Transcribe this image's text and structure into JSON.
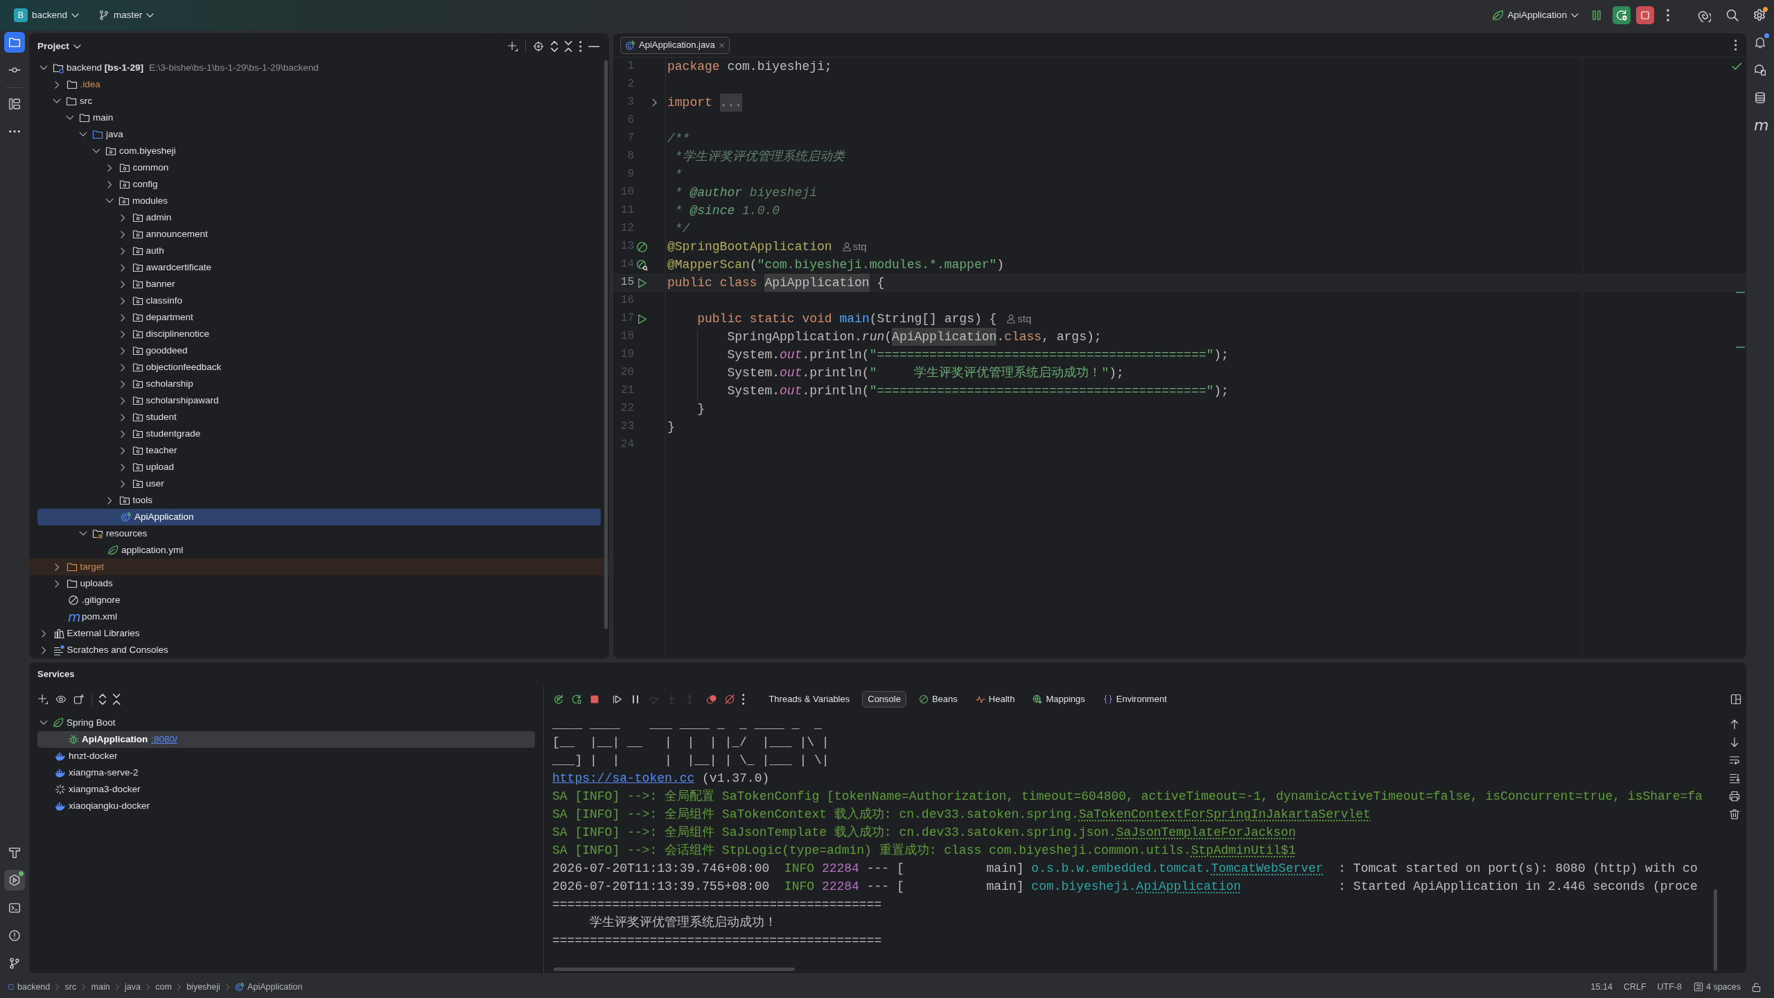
{
  "title_bar": {
    "project_badge": "B",
    "project_name": "backend",
    "branch": "master",
    "run_configuration": "ApiApplication",
    "settings_dot": true
  },
  "left_toolbar": {
    "top": [
      {
        "kind": "project",
        "selected": true
      },
      {
        "kind": "commit",
        "selected": false
      },
      {
        "kind": "structure",
        "selected": false
      },
      {
        "kind": "more",
        "selected": false
      }
    ],
    "bottom": [
      {
        "kind": "build",
        "selected": false,
        "dot": false
      },
      {
        "kind": "services",
        "selected": true,
        "dot": true
      },
      {
        "kind": "terminal",
        "selected": false,
        "dot": false
      },
      {
        "kind": "problems",
        "selected": false,
        "dot": false
      },
      {
        "kind": "git",
        "selected": false,
        "dot": false
      }
    ]
  },
  "right_toolbar": [
    {
      "kind": "notifications",
      "dot": true
    },
    {
      "kind": "ai_chat",
      "dot": false
    },
    {
      "kind": "database",
      "dot": false
    },
    {
      "kind": "maven",
      "glyph": "m",
      "dot": false
    }
  ],
  "project_panel": {
    "title": "Project",
    "tree": [
      {
        "label": "backend",
        "qualifier": "[bs-1-29]",
        "path": "E:\\3-bishe\\bs-1\\bs-1-29\\bs-1-29\\backend",
        "kind": "module",
        "expanded": true,
        "selected": false,
        "children": [
          {
            "label": ".idea",
            "kind": "ignored_folder",
            "expanded": false,
            "selected": false
          },
          {
            "label": "src",
            "kind": "folder",
            "expanded": true,
            "selected": false,
            "children": [
              {
                "label": "main",
                "kind": "folder",
                "expanded": true,
                "selected": false,
                "children": [
                  {
                    "label": "java",
                    "kind": "source_root",
                    "expanded": true,
                    "selected": false,
                    "children": [
                      {
                        "label": "com.biyesheji",
                        "kind": "package",
                        "expanded": true,
                        "selected": false,
                        "children": [
                          {
                            "label": "common",
                            "kind": "package",
                            "expanded": false,
                            "selected": false
                          },
                          {
                            "label": "config",
                            "kind": "package",
                            "expanded": false,
                            "selected": false
                          },
                          {
                            "label": "modules",
                            "kind": "package",
                            "expanded": true,
                            "selected": false,
                            "children": [
                              {
                                "label": "admin",
                                "kind": "package",
                                "expanded": false,
                                "selected": false
                              },
                              {
                                "label": "announcement",
                                "kind": "package",
                                "expanded": false,
                                "selected": false
                              },
                              {
                                "label": "auth",
                                "kind": "package",
                                "expanded": false,
                                "selected": false
                              },
                              {
                                "label": "awardcertificate",
                                "kind": "package",
                                "expanded": false,
                                "selected": false
                              },
                              {
                                "label": "banner",
                                "kind": "package",
                                "expanded": false,
                                "selected": false
                              },
                              {
                                "label": "classinfo",
                                "kind": "package",
                                "expanded": false,
                                "selected": false
                              },
                              {
                                "label": "department",
                                "kind": "package",
                                "expanded": false,
                                "selected": false
                              },
                              {
                                "label": "disciplinenotice",
                                "kind": "package",
                                "expanded": false,
                                "selected": false
                              },
                              {
                                "label": "gooddeed",
                                "kind": "package",
                                "expanded": false,
                                "selected": false
                              },
                              {
                                "label": "objectionfeedback",
                                "kind": "package",
                                "expanded": false,
                                "selected": false
                              },
                              {
                                "label": "scholarship",
                                "kind": "package",
                                "expanded": false,
                                "selected": false
                              },
                              {
                                "label": "scholarshipaward",
                                "kind": "package",
                                "expanded": false,
                                "selected": false
                              },
                              {
                                "label": "student",
                                "kind": "package",
                                "expanded": false,
                                "selected": false
                              },
                              {
                                "label": "studentgrade",
                                "kind": "package",
                                "expanded": false,
                                "selected": false
                              },
                              {
                                "label": "teacher",
                                "kind": "package",
                                "expanded": false,
                                "selected": false
                              },
                              {
                                "label": "upload",
                                "kind": "package",
                                "expanded": false,
                                "selected": false
                              },
                              {
                                "label": "user",
                                "kind": "package",
                                "expanded": false,
                                "selected": false
                              }
                            ]
                          },
                          {
                            "label": "tools",
                            "kind": "package",
                            "expanded": false,
                            "selected": false
                          },
                          {
                            "label": "ApiApplication",
                            "kind": "spring_class",
                            "selected": true
                          }
                        ]
                      }
                    ]
                  },
                  {
                    "label": "resources",
                    "kind": "resources_root",
                    "expanded": true,
                    "selected": false,
                    "children": [
                      {
                        "label": "application.yml",
                        "kind": "spring_config",
                        "selected": false
                      }
                    ]
                  }
                ]
              }
            ]
          },
          {
            "label": "target",
            "kind": "excluded_folder",
            "expanded": false,
            "selected": false
          },
          {
            "label": "uploads",
            "kind": "folder",
            "expanded": false,
            "selected": false
          },
          {
            "label": ".gitignore",
            "kind": "ignore_file",
            "selected": false
          },
          {
            "label": "pom.xml",
            "kind": "maven_file",
            "glyph": "m",
            "selected": false
          }
        ]
      },
      {
        "label": "External Libraries",
        "kind": "libraries",
        "expanded": false,
        "selected": false
      },
      {
        "label": "Scratches and Consoles",
        "kind": "scratches",
        "expanded": false,
        "selected": false
      }
    ]
  },
  "editor": {
    "tabs": [
      {
        "label": "ApiApplication.java",
        "kind": "spring_class",
        "selected": true
      }
    ],
    "analysis_ok": true,
    "lines": [
      {
        "number": "1",
        "kind": "plain",
        "current": false,
        "tokens": [
          {
            "text": "package",
            "kind": "keyword"
          },
          {
            "text": " com.biyesheji;",
            "kind": "plain"
          }
        ]
      },
      {
        "number": "2",
        "kind": "plain",
        "current": false
      },
      {
        "number": "3",
        "kind": "fold",
        "current": false,
        "tokens": [
          {
            "text": "import ",
            "kind": "keyword"
          },
          {
            "text": "...",
            "kind": "folded"
          }
        ]
      },
      {
        "number": "6",
        "kind": "plain",
        "current": false
      },
      {
        "number": "7",
        "kind": "plain",
        "current": false,
        "tokens": [
          {
            "text": "/**",
            "kind": "doc"
          }
        ]
      },
      {
        "number": "8",
        "kind": "plain",
        "current": false,
        "tokens": [
          {
            "text": " *学生评奖评优管理系统启动类",
            "kind": "doc"
          }
        ]
      },
      {
        "number": "9",
        "kind": "plain",
        "current": false,
        "tokens": [
          {
            "text": " *",
            "kind": "doc"
          }
        ]
      },
      {
        "number": "10",
        "kind": "plain",
        "current": false,
        "tokens": [
          {
            "text": " * ",
            "kind": "doc"
          },
          {
            "text": "@author",
            "kind": "doc_tag"
          },
          {
            "text": " biyesheji",
            "kind": "doc"
          }
        ]
      },
      {
        "number": "11",
        "kind": "plain",
        "current": false,
        "tokens": [
          {
            "text": " * ",
            "kind": "doc"
          },
          {
            "text": "@since",
            "kind": "doc_tag"
          },
          {
            "text": " 1.0.0",
            "kind": "doc"
          }
        ]
      },
      {
        "number": "12",
        "kind": "plain",
        "current": false,
        "tokens": [
          {
            "text": " */",
            "kind": "doc"
          }
        ]
      },
      {
        "number": "13",
        "kind": "bean",
        "current": false,
        "hint": "stq",
        "tokens": [
          {
            "text": "@SpringBootApplication",
            "kind": "annotation"
          }
        ]
      },
      {
        "number": "14",
        "kind": "bean_search",
        "current": false,
        "tokens": [
          {
            "text": "@MapperScan",
            "kind": "annotation"
          },
          {
            "text": "(",
            "kind": "plain"
          },
          {
            "text": "\"com.biyesheji.modules.*.mapper\"",
            "kind": "string"
          },
          {
            "text": ")",
            "kind": "plain"
          }
        ]
      },
      {
        "number": "15",
        "kind": "run",
        "current": true,
        "tokens": [
          {
            "text": "public ",
            "kind": "keyword"
          },
          {
            "text": "class ",
            "kind": "keyword"
          },
          {
            "text": "ApiApplication",
            "kind": "usage"
          },
          {
            "text": " {",
            "kind": "plain"
          }
        ]
      },
      {
        "number": "16",
        "kind": "plain",
        "current": false
      },
      {
        "number": "17",
        "kind": "run",
        "current": false,
        "hint": "stq",
        "tokens": [
          {
            "text": "    public ",
            "kind": "keyword"
          },
          {
            "text": "static ",
            "kind": "keyword"
          },
          {
            "text": "void ",
            "kind": "keyword"
          },
          {
            "text": "main",
            "kind": "method"
          },
          {
            "text": "(String[] args) {",
            "kind": "plain"
          }
        ]
      },
      {
        "number": "18",
        "kind": "plain",
        "current": false,
        "tokens": [
          {
            "text": "        SpringApplication.",
            "kind": "plain"
          },
          {
            "text": "run",
            "kind": "static_call"
          },
          {
            "text": "(",
            "kind": "plain"
          },
          {
            "text": "ApiApplication",
            "kind": "usage"
          },
          {
            "text": ".",
            "kind": "plain"
          },
          {
            "text": "class",
            "kind": "keyword"
          },
          {
            "text": ", args);",
            "kind": "plain"
          }
        ]
      },
      {
        "number": "19",
        "kind": "plain",
        "current": false,
        "tokens": [
          {
            "text": "        System.",
            "kind": "plain"
          },
          {
            "text": "out",
            "kind": "static_field"
          },
          {
            "text": ".println(",
            "kind": "plain"
          },
          {
            "text": "\"============================================\"",
            "kind": "string"
          },
          {
            "text": ");",
            "kind": "plain"
          }
        ]
      },
      {
        "number": "20",
        "kind": "plain",
        "current": false,
        "tokens": [
          {
            "text": "        System.",
            "kind": "plain"
          },
          {
            "text": "out",
            "kind": "static_field"
          },
          {
            "text": ".println(",
            "kind": "plain"
          },
          {
            "text": "\"     学生评奖评优管理系统启动成功！\"",
            "kind": "string"
          },
          {
            "text": ");",
            "kind": "plain"
          }
        ]
      },
      {
        "number": "21",
        "kind": "plain",
        "current": false,
        "tokens": [
          {
            "text": "        System.",
            "kind": "plain"
          },
          {
            "text": "out",
            "kind": "static_field"
          },
          {
            "text": ".println(",
            "kind": "plain"
          },
          {
            "text": "\"============================================\"",
            "kind": "string"
          },
          {
            "text": ");",
            "kind": "plain"
          }
        ]
      },
      {
        "number": "22",
        "kind": "plain",
        "current": false,
        "tokens": [
          {
            "text": "    }",
            "kind": "plain"
          }
        ]
      },
      {
        "number": "23",
        "kind": "plain",
        "current": false,
        "tokens": [
          {
            "text": "}",
            "kind": "plain"
          }
        ]
      },
      {
        "number": "24",
        "kind": "plain",
        "current": false
      }
    ]
  },
  "services": {
    "title": "Services",
    "tree": [
      {
        "label": "Spring Boot",
        "kind": "spring_boot",
        "expanded": true,
        "selected": false,
        "children": [
          {
            "label": "ApiApplication",
            "port": ":8080/",
            "kind": "spring_app",
            "selected": true
          }
        ]
      },
      {
        "label": "hnzt-docker",
        "kind": "docker",
        "selected": false
      },
      {
        "label": "xiangma-serve-2",
        "kind": "docker",
        "selected": false
      },
      {
        "label": "xiangma3-docker",
        "kind": "docker_pending",
        "selected": false
      },
      {
        "label": "xiaoqiangku-docker",
        "kind": "docker",
        "selected": false
      }
    ],
    "debug_toolbar": [
      {
        "kind": "rerun",
        "disabled": false
      },
      {
        "kind": "rerun_debug",
        "disabled": false
      },
      {
        "kind": "stop",
        "disabled": false
      },
      {
        "kind": "resume",
        "disabled": false
      },
      {
        "kind": "pause",
        "disabled": false
      },
      {
        "kind": "step_over",
        "disabled": true
      },
      {
        "kind": "step_into",
        "disabled": true
      },
      {
        "kind": "step_out",
        "disabled": true
      },
      {
        "kind": "breakpoints",
        "disabled": false
      },
      {
        "kind": "mute_breakpoints",
        "disabled": false
      }
    ],
    "tabs": [
      {
        "label": "Threads & Variables",
        "kind": "threads",
        "selected": false
      },
      {
        "label": "Console",
        "kind": "console",
        "selected": true
      },
      {
        "label": "Beans",
        "kind": "beans",
        "selected": false
      },
      {
        "label": "Health",
        "kind": "health",
        "selected": false
      },
      {
        "label": "Mappings",
        "kind": "mappings",
        "selected": false
      },
      {
        "label": "Environment",
        "kind": "environment",
        "selected": false
      }
    ],
    "console": [
      {
        "tokens": [
          {
            "text": "____ ____    ___ ____ _  _ ____ _  _",
            "kind": "plain"
          }
        ]
      },
      {
        "tokens": [
          {
            "text": "[__  |__| __   |  |  | |_/  |___ |\\ |",
            "kind": "plain"
          }
        ]
      },
      {
        "tokens": [
          {
            "text": "___] |  |      |  |__| | \\_ |___ | \\|",
            "kind": "plain"
          }
        ]
      },
      {
        "tokens": [
          {
            "text": "https://sa-token.cc",
            "kind": "url"
          },
          {
            "text": " (v1.37.0)",
            "kind": "plain"
          }
        ]
      },
      {
        "tokens": [
          {
            "text": "SA [INFO] -->: 全局配置 SaTokenConfig [tokenName=Authorization, timeout=604800, activeTimeout=-1, dynamicActiveTimeout=false, isConcurrent=true, isShare=fa",
            "kind": "sa"
          }
        ]
      },
      {
        "tokens": [
          {
            "text": "SA [INFO] -->: 全局组件 SaTokenContext 载入成功: cn.dev33.satoken.spring.",
            "kind": "sa"
          },
          {
            "text": "SaTokenContextForSpringInJakartaServlet",
            "kind": "sa_link"
          }
        ]
      },
      {
        "tokens": [
          {
            "text": "SA [INFO] -->: 全局组件 SaJsonTemplate 载入成功: cn.dev33.satoken.spring.json.",
            "kind": "sa"
          },
          {
            "text": "SaJsonTemplateForJackson",
            "kind": "sa_link"
          }
        ]
      },
      {
        "tokens": [
          {
            "text": "SA [INFO] -->: 会话组件 StpLogic(type=admin) 重置成功: class com.biyesheji.common.utils.",
            "kind": "sa"
          },
          {
            "text": "StpAdminUtil$1",
            "kind": "sa_link"
          }
        ]
      },
      {
        "tokens": [
          {
            "text": "2026-07-20T11:13:39.746+08:00  ",
            "kind": "plain"
          },
          {
            "text": "INFO ",
            "kind": "level"
          },
          {
            "text": "22284",
            "kind": "pid"
          },
          {
            "text": " --- [           main] ",
            "kind": "plain"
          },
          {
            "text": "o.s.b.w.embedded.tomcat.",
            "kind": "logger"
          },
          {
            "text": "TomcatWebServer",
            "kind": "logger_link"
          },
          {
            "text": "  : Tomcat started on port(s): 8080 (http) with co",
            "kind": "plain"
          }
        ]
      },
      {
        "tokens": [
          {
            "text": "2026-07-20T11:13:39.755+08:00  ",
            "kind": "plain"
          },
          {
            "text": "INFO ",
            "kind": "level"
          },
          {
            "text": "22284",
            "kind": "pid"
          },
          {
            "text": " --- [           main] ",
            "kind": "plain"
          },
          {
            "text": "com.biyesheji.",
            "kind": "logger"
          },
          {
            "text": "ApiApplication",
            "kind": "logger_link"
          },
          {
            "text": "             : Started ApiApplication in 2.446 seconds (proce",
            "kind": "plain"
          }
        ]
      },
      {
        "tokens": [
          {
            "text": "============================================",
            "kind": "plain"
          }
        ]
      },
      {
        "tokens": [
          {
            "text": "     学生评奖评优管理系统启动成功！",
            "kind": "plain"
          }
        ]
      },
      {
        "tokens": [
          {
            "text": "============================================",
            "kind": "plain"
          }
        ]
      }
    ]
  },
  "status_bar": {
    "breadcrumbs": [
      {
        "label": "backend",
        "kind": "module"
      },
      {
        "label": "src",
        "kind": "folder"
      },
      {
        "label": "main",
        "kind": "folder"
      },
      {
        "label": "java",
        "kind": "folder"
      },
      {
        "label": "com",
        "kind": "folder"
      },
      {
        "label": "biyesheji",
        "kind": "folder"
      },
      {
        "label": "ApiApplication",
        "kind": "spring_class"
      }
    ],
    "caret": "15:14",
    "line_separator": "CRLF",
    "encoding": "UTF-8",
    "indent": "4 spaces"
  }
}
